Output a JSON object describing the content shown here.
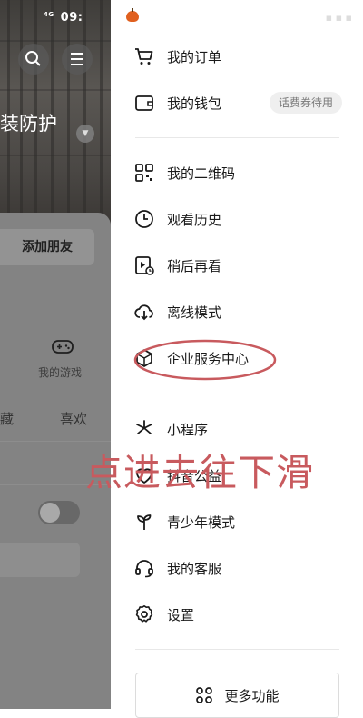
{
  "background_app": {
    "status_time": "09:",
    "status_signal": "4G",
    "headline": "装防护",
    "add_friend_button": "添加朋友",
    "games_label": "我的游戏",
    "tabs": [
      "藏",
      "喜欢"
    ]
  },
  "drawer": {
    "items": [
      {
        "label": "我的订单",
        "icon": "cart-icon"
      },
      {
        "label": "我的钱包",
        "icon": "wallet-icon",
        "badge": "话费券待用"
      },
      {
        "label": "我的二维码",
        "icon": "qrcode-icon"
      },
      {
        "label": "观看历史",
        "icon": "clock-icon"
      },
      {
        "label": "稍后再看",
        "icon": "watch-later-icon"
      },
      {
        "label": "离线模式",
        "icon": "cloud-download-icon"
      },
      {
        "label": "企业服务中心",
        "icon": "enterprise-icon"
      },
      {
        "label": "小程序",
        "icon": "miniprogram-icon"
      },
      {
        "label": "抖音公益",
        "icon": "charity-icon"
      },
      {
        "label": "青少年模式",
        "icon": "sprout-icon"
      },
      {
        "label": "我的客服",
        "icon": "headset-icon"
      },
      {
        "label": "设置",
        "icon": "gear-icon"
      }
    ],
    "more_button": "更多功能"
  },
  "annotation": {
    "text": "点进去往下滑",
    "color": "#c85a5e"
  }
}
